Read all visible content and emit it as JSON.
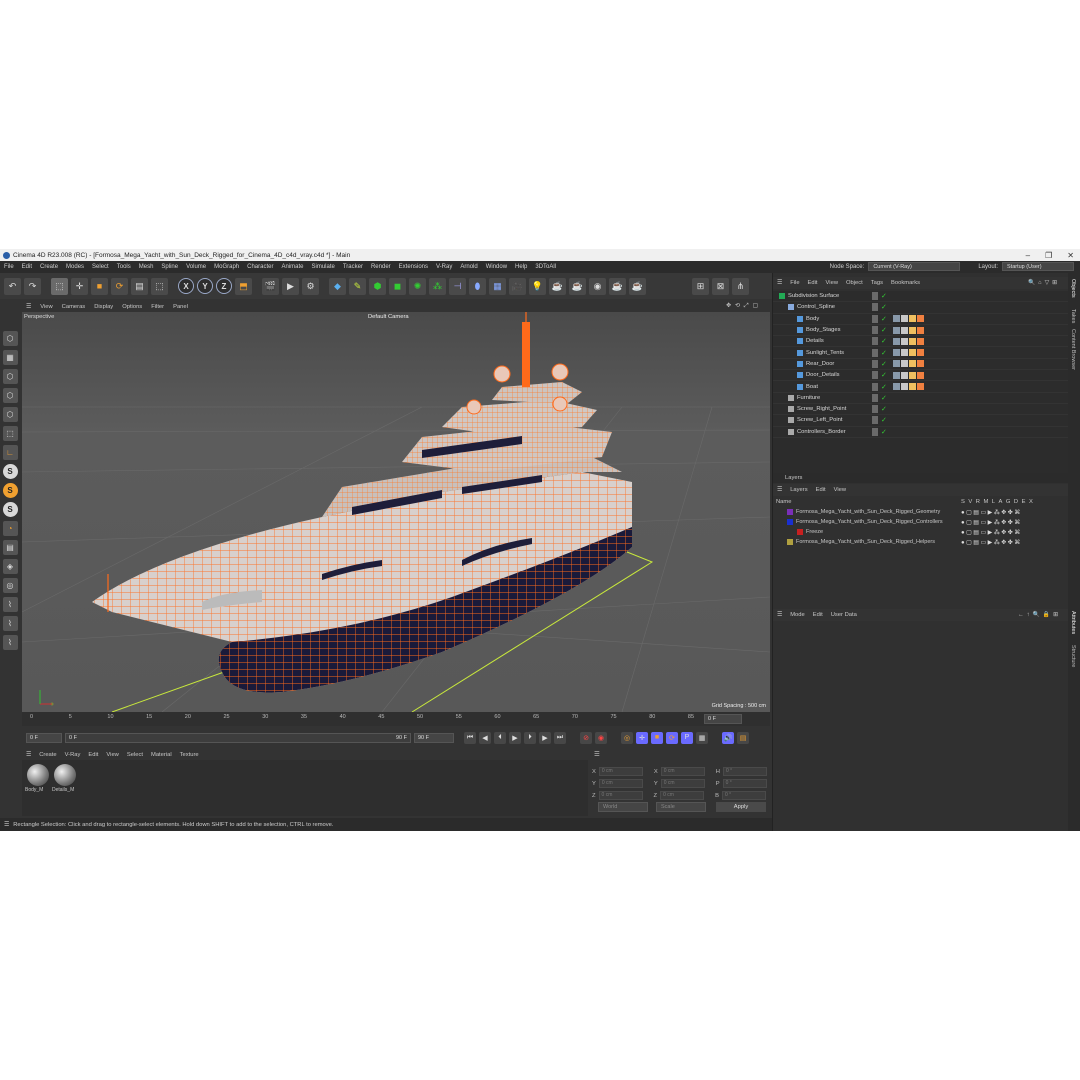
{
  "window": {
    "title": "Cinema 4D R23.008 (RC) - [Formosa_Mega_Yacht_with_Sun_Deck_Rigged_for_Cinema_4D_c4d_vray.c4d *] - Main",
    "minimize": "–",
    "maximize": "❐",
    "close": "✕"
  },
  "menubar": {
    "items": [
      "File",
      "Edit",
      "Create",
      "Modes",
      "Select",
      "Tools",
      "Mesh",
      "Spline",
      "Volume",
      "MoGraph",
      "Character",
      "Animate",
      "Simulate",
      "Tracker",
      "Render",
      "Extensions",
      "V-Ray",
      "Arnold",
      "Window",
      "Help",
      "3DToAll"
    ],
    "node_space_label": "Node Space:",
    "node_space_value": "Current (V-Ray)",
    "layout_label": "Layout:",
    "layout_value": "Startup (User)"
  },
  "toolbar": {
    "axis_x": "X",
    "axis_y": "Y",
    "axis_z": "Z"
  },
  "viewport_menu": {
    "items": [
      "View",
      "Cameras",
      "Display",
      "Options",
      "Filter",
      "Panel"
    ],
    "view_name": "Perspective",
    "camera": "Default Camera",
    "grid_spacing": "Grid Spacing : 500 cm"
  },
  "timeline": {
    "ticks": [
      "0",
      "5",
      "10",
      "15",
      "20",
      "25",
      "30",
      "35",
      "40",
      "45",
      "50",
      "55",
      "60",
      "65",
      "70",
      "75",
      "80",
      "85",
      "90"
    ],
    "end_field": "0 F"
  },
  "playbar": {
    "start_frame": "0 F",
    "current_frame": "0 F",
    "end_frame_a": "90 F",
    "end_frame_b": "90 F"
  },
  "material_menu": {
    "items": [
      "Create",
      "V-Ray",
      "Edit",
      "View",
      "Select",
      "Material",
      "Texture"
    ],
    "materials": [
      "Body_M",
      "Details_M"
    ]
  },
  "coordinates": {
    "rows": [
      {
        "a": "X",
        "av": "0 cm",
        "b": "X",
        "bv": "0 cm",
        "c": "H",
        "cv": "0 °"
      },
      {
        "a": "Y",
        "av": "0 cm",
        "b": "Y",
        "bv": "0 cm",
        "c": "P",
        "cv": "0 °"
      },
      {
        "a": "Z",
        "av": "0 cm",
        "b": "Z",
        "bv": "0 cm",
        "c": "B",
        "cv": "0 °"
      }
    ],
    "mode": "World",
    "scale": "Scale",
    "apply": "Apply"
  },
  "status": {
    "text": "Rectangle Selection: Click and drag to rectangle-select elements. Hold down SHIFT to add to the selection, CTRL to remove."
  },
  "object_manager": {
    "menu": [
      "File",
      "Edit",
      "View",
      "Object",
      "Tags",
      "Bookmarks"
    ],
    "objects": [
      {
        "name": "Subdivision Surface",
        "indent": 0,
        "color": "#22aa55"
      },
      {
        "name": "Control_Spline",
        "indent": 1,
        "color": "#88aadd"
      },
      {
        "name": "Body",
        "indent": 2,
        "color": "#5599dd"
      },
      {
        "name": "Body_Stages",
        "indent": 2,
        "color": "#5599dd"
      },
      {
        "name": "Details",
        "indent": 2,
        "color": "#5599dd"
      },
      {
        "name": "Sunlight_Tents",
        "indent": 2,
        "color": "#5599dd"
      },
      {
        "name": "Rear_Door",
        "indent": 2,
        "color": "#5599dd"
      },
      {
        "name": "Door_Details",
        "indent": 2,
        "color": "#5599dd"
      },
      {
        "name": "Boat",
        "indent": 2,
        "color": "#5599dd"
      },
      {
        "name": "Furniture",
        "indent": 1,
        "color": "#aaaaaa"
      },
      {
        "name": "Screw_Right_Point",
        "indent": 1,
        "color": "#aaaaaa"
      },
      {
        "name": "Screw_Left_Point",
        "indent": 1,
        "color": "#aaaaaa"
      },
      {
        "name": "Controllers_Border",
        "indent": 1,
        "color": "#aaaaaa"
      }
    ]
  },
  "layers": {
    "title": "Layers",
    "menu": [
      "Layers",
      "Edit",
      "View"
    ],
    "name_header": "Name",
    "columns": [
      "S",
      "V",
      "R",
      "M",
      "L",
      "A",
      "G",
      "D",
      "E",
      "X"
    ],
    "items": [
      {
        "name": "Formosa_Mega_Yacht_with_Sun_Deck_Rigged_Geometry",
        "color": "#7a2fb8",
        "indent": 0
      },
      {
        "name": "Formosa_Mega_Yacht_with_Sun_Deck_Rigged_Controllers",
        "color": "#1a2fd0",
        "indent": 0
      },
      {
        "name": "Freeze",
        "color": "#c82020",
        "indent": 1
      },
      {
        "name": "Formosa_Mega_Yacht_with_Sun_Deck_Rigged_Helpers",
        "color": "#b0a040",
        "indent": 0
      }
    ]
  },
  "attributes": {
    "menu": [
      "Mode",
      "Edit",
      "User Data"
    ]
  },
  "side_tabs": [
    "Objects",
    "Takes",
    "Content Browser",
    "Attributes",
    "Structure"
  ],
  "colors": {
    "wire": "#ff6a1a",
    "hull": "#1a1a3a",
    "timeline_green": "#c8e83c"
  }
}
